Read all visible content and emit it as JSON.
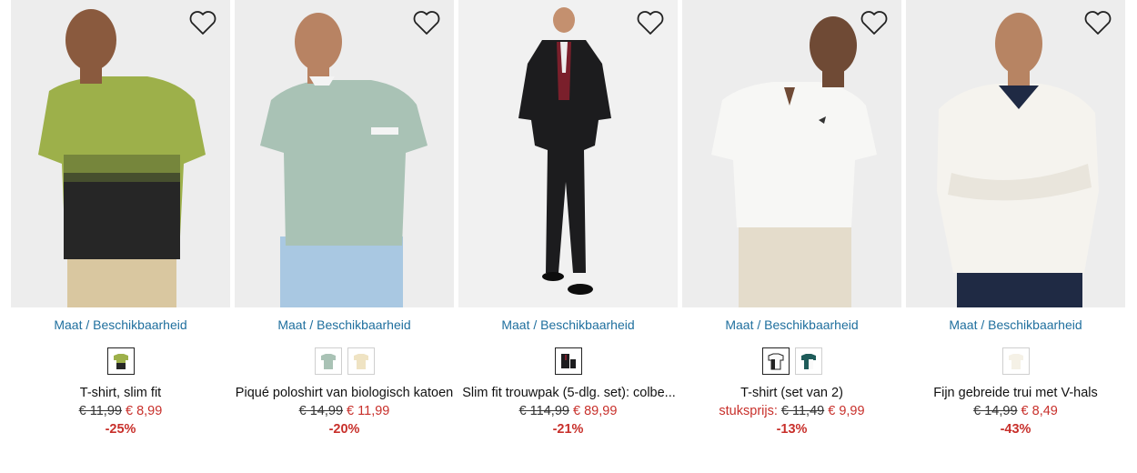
{
  "products": [
    {
      "size_link": "Maat / Beschikbaarheid",
      "title": "T-shirt, slim fit",
      "price_label": "",
      "old_price": "€ 11,99",
      "new_price": "€ 8,99",
      "discount": "-25%",
      "colors": {
        "background": "#ececec",
        "shirt_top": "#9db04a",
        "shirt_bottom": "#262626",
        "pants": "#d9c7a0"
      }
    },
    {
      "size_link": "Maat / Beschikbaarheid",
      "title": "Piqué poloshirt van biologisch katoen",
      "price_label": "",
      "old_price": "€ 14,99",
      "new_price": "€ 11,99",
      "discount": "-20%",
      "colors": {
        "background": "#ececec",
        "shirt": "#a9c2b5",
        "pants": "#a9c8e2"
      }
    },
    {
      "size_link": "Maat / Beschikbaarheid",
      "title": "Slim fit trouwpak (5-dlg. set): colbe...",
      "price_label": "",
      "old_price": "€ 114,99",
      "new_price": "€ 89,99",
      "discount": "-21%",
      "colors": {
        "background": "#f1f1f1",
        "suit": "#1c1c1e",
        "vest": "#7a1f2b"
      }
    },
    {
      "size_link": "Maat / Beschikbaarheid",
      "title": "T-shirt (set van 2)",
      "price_label": "stuksprijs:",
      "old_price": "€ 11,49",
      "new_price": "€ 9,99",
      "discount": "-13%",
      "colors": {
        "background": "#ececec",
        "shirt": "#f7f7f5",
        "pants": "#e4dccb"
      }
    },
    {
      "size_link": "Maat / Beschikbaarheid",
      "title": "Fijn gebreide trui met V-hals",
      "price_label": "",
      "old_price": "€ 14,99",
      "new_price": "€ 8,49",
      "discount": "-43%",
      "colors": {
        "background": "#ececec",
        "sweater": "#f5f3ee",
        "pants": "#1f2a44"
      }
    }
  ]
}
